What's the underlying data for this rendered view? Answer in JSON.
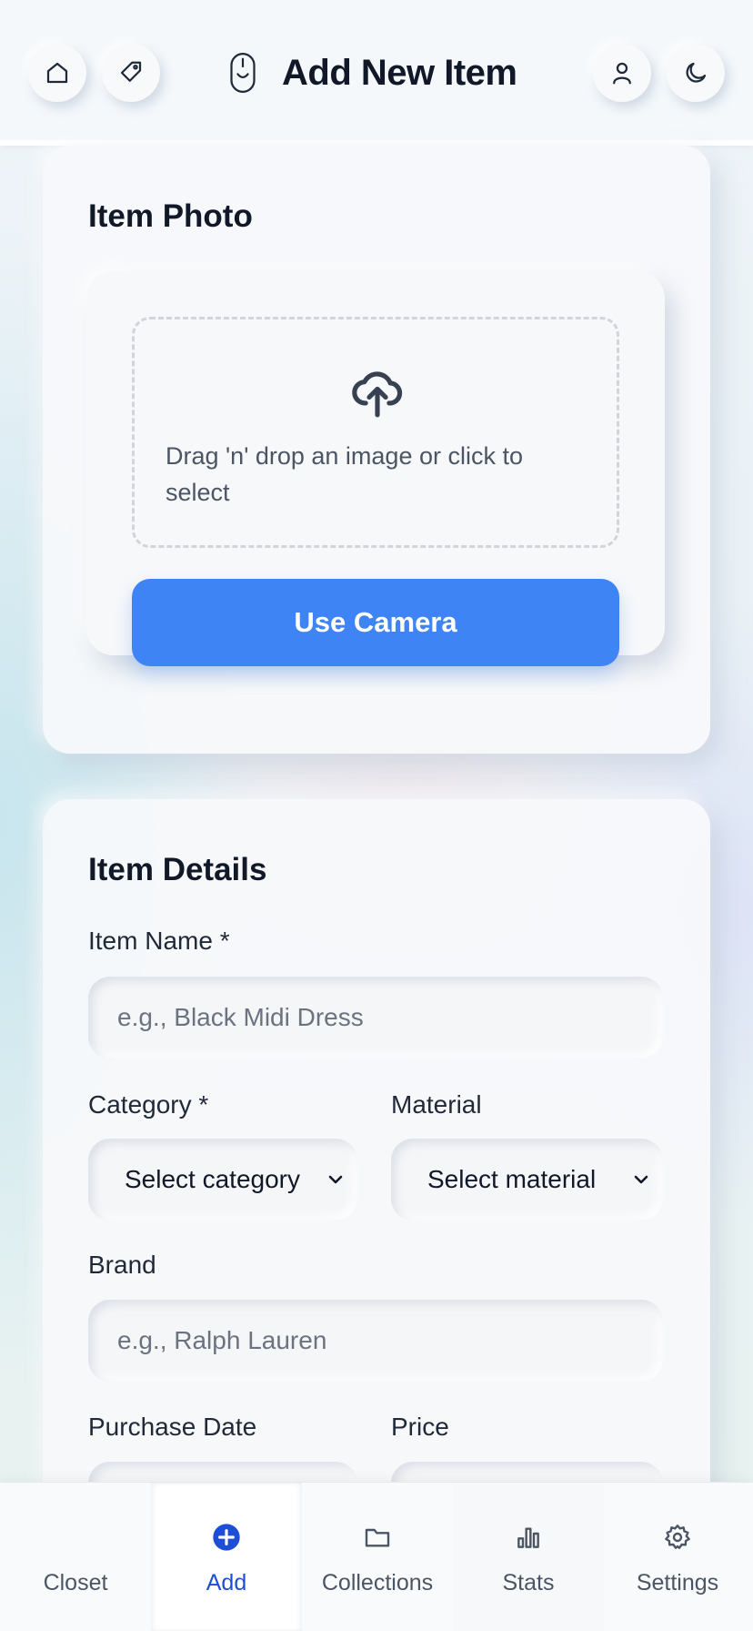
{
  "header": {
    "title": "Add New Item",
    "icons": {
      "home": "home-icon",
      "tag": "tag-icon",
      "logo": "mouse-icon",
      "profile": "user-icon",
      "theme": "moon-icon"
    }
  },
  "photo_card": {
    "title": "Item Photo",
    "dropzone_text": "Drag 'n' drop an image or click to select",
    "upload_icon": "cloud-upload-icon",
    "camera_button": "Use Camera"
  },
  "details_card": {
    "title": "Item Details",
    "item_name": {
      "label": "Item Name *",
      "placeholder": "e.g., Black Midi Dress"
    },
    "category": {
      "label": "Category *",
      "value": "Select category"
    },
    "material": {
      "label": "Material",
      "value": "Select material"
    },
    "brand": {
      "label": "Brand",
      "placeholder": "e.g., Ralph Lauren"
    },
    "purchase_date": {
      "label": "Purchase Date"
    },
    "price": {
      "label": "Price"
    }
  },
  "bottom_nav": {
    "items": [
      {
        "label": "Closet",
        "icon": "closet-icon"
      },
      {
        "label": "Add",
        "icon": "plus-circle-icon",
        "active": true
      },
      {
        "label": "Collections",
        "icon": "folder-icon"
      },
      {
        "label": "Stats",
        "icon": "bar-chart-icon"
      },
      {
        "label": "Settings",
        "icon": "gear-icon"
      }
    ]
  },
  "colors": {
    "accent": "#3f84f4",
    "active_nav": "#1d4ed8",
    "text": "#111827"
  }
}
